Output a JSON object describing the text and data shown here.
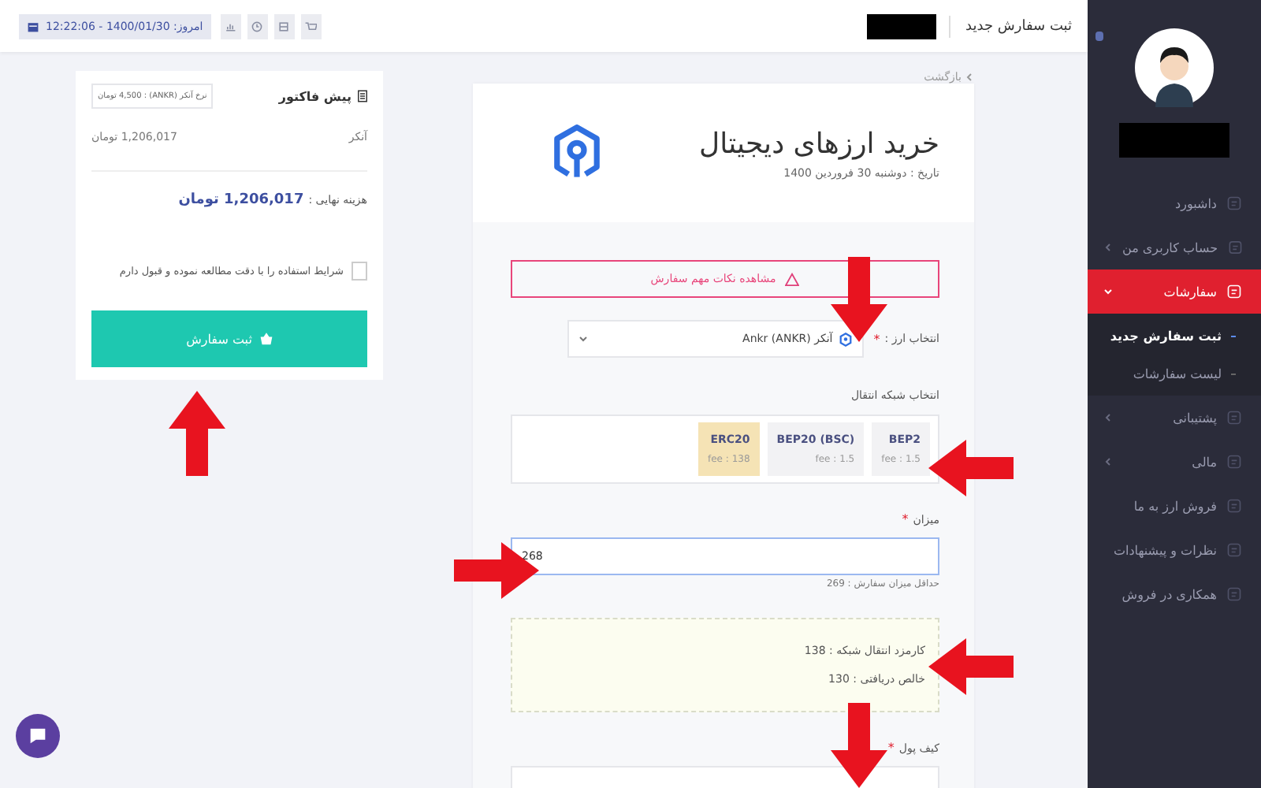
{
  "topbar": {
    "title": "ثبت سفارش جدید",
    "date_badge": "امروز: 1400/01/30 - 12:22:06"
  },
  "sidebar": {
    "items": [
      {
        "label": "داشبورد",
        "kind": "link",
        "selected": false
      },
      {
        "label": "حساب کاربری من",
        "kind": "submenu",
        "selected": false,
        "expanded": false
      },
      {
        "label": "سفارشات",
        "kind": "submenu",
        "selected": true,
        "expanded": true,
        "children": [
          {
            "label": "ثبت سفارش جدید",
            "selected": true
          },
          {
            "label": "لیست سفارشات",
            "selected": false
          }
        ]
      },
      {
        "label": "پشتیبانی",
        "kind": "submenu",
        "selected": false,
        "expanded": false
      },
      {
        "label": "مالی",
        "kind": "submenu",
        "selected": false,
        "expanded": false
      },
      {
        "label": "فروش ارز به ما",
        "kind": "link",
        "selected": false
      },
      {
        "label": "نظرات و پیشنهادات",
        "kind": "link",
        "selected": false
      },
      {
        "label": "همکاری در فروش",
        "kind": "link",
        "selected": false
      }
    ]
  },
  "back_link": "بازگشت",
  "order": {
    "title": "خرید ارزهای دیجیتال",
    "date": "تاریخ : دوشنبه 30 فروردین 1400",
    "alert": "مشاهده نکات مهم سفارش",
    "currency": {
      "label": "انتخاب ارز :",
      "required_mark": "*",
      "value": "آنکر (ANKR) Ankr"
    },
    "network": {
      "label": "انتخاب شبکه انتقال",
      "options": [
        {
          "name": "BEP2",
          "fee": "fee : 1.5",
          "selected": false
        },
        {
          "name": "BEP20 (BSC)",
          "fee": "fee : 1.5",
          "selected": false
        },
        {
          "name": "ERC20",
          "fee": "fee : 138",
          "selected": true
        }
      ]
    },
    "amount": {
      "label": "میزان",
      "required_mark": "*",
      "value": "268",
      "hint": "حداقل میزان سفارش : 269"
    },
    "summary": [
      "کارمزد انتقال شبکه : 138",
      "خالص دریافتی : 130"
    ],
    "wallet": {
      "label": "کیف پول",
      "required_mark": "*"
    }
  },
  "invoice": {
    "title": "پیش فاکتور",
    "rate": "نرخ آنکر (ANKR) : 4,500 تومان",
    "item": "آنکر",
    "item_price": "1,206,017 تومان",
    "total_label": "هزینه نهایی :",
    "total": "1,206,017 تومان",
    "terms": "شرایط استفاده را با دقت مطالعه نموده و قبول دارم",
    "terms_checked": false,
    "submit": "ثبت سفارش"
  }
}
